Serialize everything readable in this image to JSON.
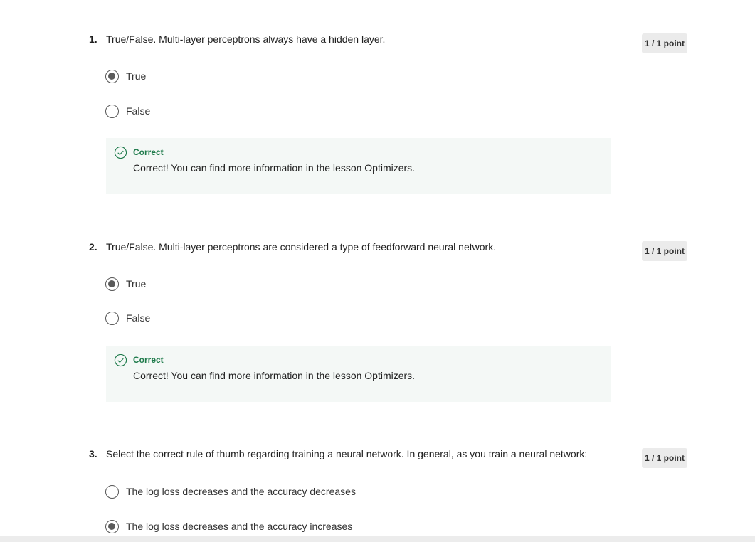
{
  "questions": [
    {
      "number": "1.",
      "text": "True/False. Multi-layer perceptrons always have a hidden layer.",
      "points": "1 / 1 point",
      "options": [
        {
          "label": "True",
          "selected": true
        },
        {
          "label": "False",
          "selected": false
        }
      ],
      "feedback": {
        "title": "Correct",
        "text": "Correct! You can find more information in the lesson Optimizers."
      }
    },
    {
      "number": "2.",
      "text": "True/False. Multi-layer perceptrons are considered a type of feedforward neural network.",
      "points": "1 / 1 point",
      "options": [
        {
          "label": "True",
          "selected": true
        },
        {
          "label": "False",
          "selected": false
        }
      ],
      "feedback": {
        "title": "Correct",
        "text": "Correct! You can find more information in the lesson Optimizers."
      }
    },
    {
      "number": "3.",
      "text": "Select the correct rule of thumb regarding training a neural network. In general, as you train a neural network:",
      "points": "1 / 1 point",
      "options": [
        {
          "label": "The log loss decreases and the accuracy decreases",
          "selected": false
        },
        {
          "label": "The log loss decreases and the accuracy increases",
          "selected": true
        }
      ]
    }
  ],
  "colors": {
    "correct_green": "#1d7a4a",
    "feedback_bg": "#f4f8f6",
    "radio_fill": "#5a5a5a",
    "points_bg": "#ebebeb"
  },
  "icons": {
    "feedback": "check-circle-icon"
  }
}
